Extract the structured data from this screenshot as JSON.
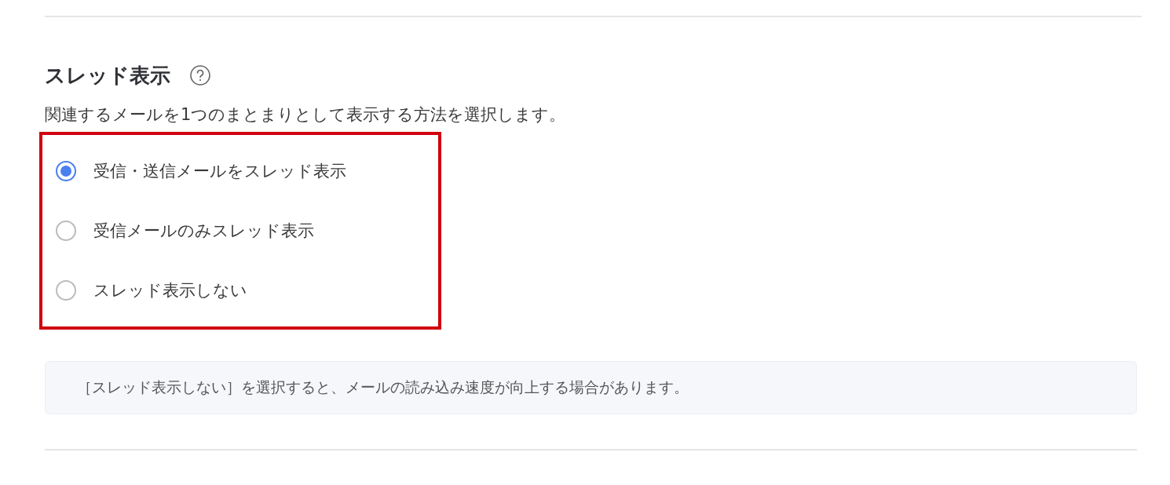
{
  "section": {
    "title": "スレッド表示",
    "description": "関連するメールを1つのまとまりとして表示する方法を選択します。"
  },
  "options": [
    {
      "label": "受信・送信メールをスレッド表示",
      "selected": true
    },
    {
      "label": "受信メールのみスレッド表示",
      "selected": false
    },
    {
      "label": "スレッド表示しない",
      "selected": false
    }
  ],
  "note": "［スレッド表示しない］を選択すると、メールの読み込み速度が向上する場合があります。"
}
